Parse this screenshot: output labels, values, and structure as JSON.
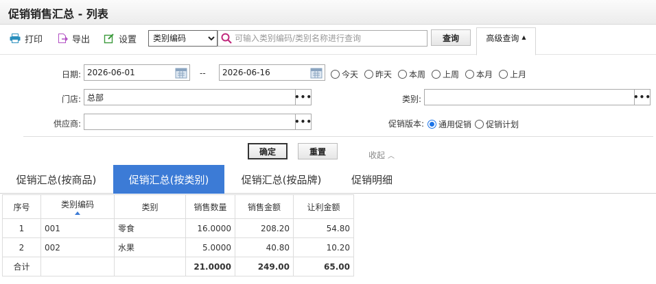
{
  "page": {
    "title": "促销销售汇总 - 列表"
  },
  "toolbar": {
    "print": "打印",
    "export": "导出",
    "settings": "设置",
    "category_select": "类别编码",
    "search_placeholder": "可输入类别编码/类别名称进行查询",
    "search_button": "查询",
    "advanced_search": "高级查询"
  },
  "filters": {
    "date_label": "日期:",
    "date_from": "2026-06-01",
    "date_sep": "--",
    "date_to": "2026-06-16",
    "quick_dates": [
      "今天",
      "昨天",
      "本周",
      "上周",
      "本月",
      "上月"
    ],
    "store_label": "门店:",
    "store_value": "总部",
    "category_label": "类别:",
    "category_value": "",
    "supplier_label": "供应商:",
    "supplier_value": "",
    "promo_version_label": "促销版本:",
    "promo_options": [
      "通用促销",
      "促销计划"
    ],
    "promo_selected": "通用促销",
    "confirm": "确定",
    "reset": "重置",
    "collapse": "收起"
  },
  "tabs": [
    {
      "label": "促销汇总(按商品)",
      "active": false
    },
    {
      "label": "促销汇总(按类别)",
      "active": true
    },
    {
      "label": "促销汇总(按品牌)",
      "active": false
    },
    {
      "label": "促销明细",
      "active": false
    }
  ],
  "table": {
    "headers": [
      "序号",
      "类别编码",
      "类别",
      "销售数量",
      "销售金额",
      "让利金额"
    ],
    "rows": [
      [
        "1",
        "001",
        "零食",
        "16.0000",
        "208.20",
        "54.80"
      ],
      [
        "2",
        "002",
        "水果",
        "5.0000",
        "40.80",
        "10.20"
      ]
    ],
    "footer": [
      "合计",
      "",
      "",
      "21.0000",
      "249.00",
      "65.00"
    ]
  },
  "colors": {
    "accent": "#3c7bd6",
    "radio_selected": "#1a73e8"
  }
}
